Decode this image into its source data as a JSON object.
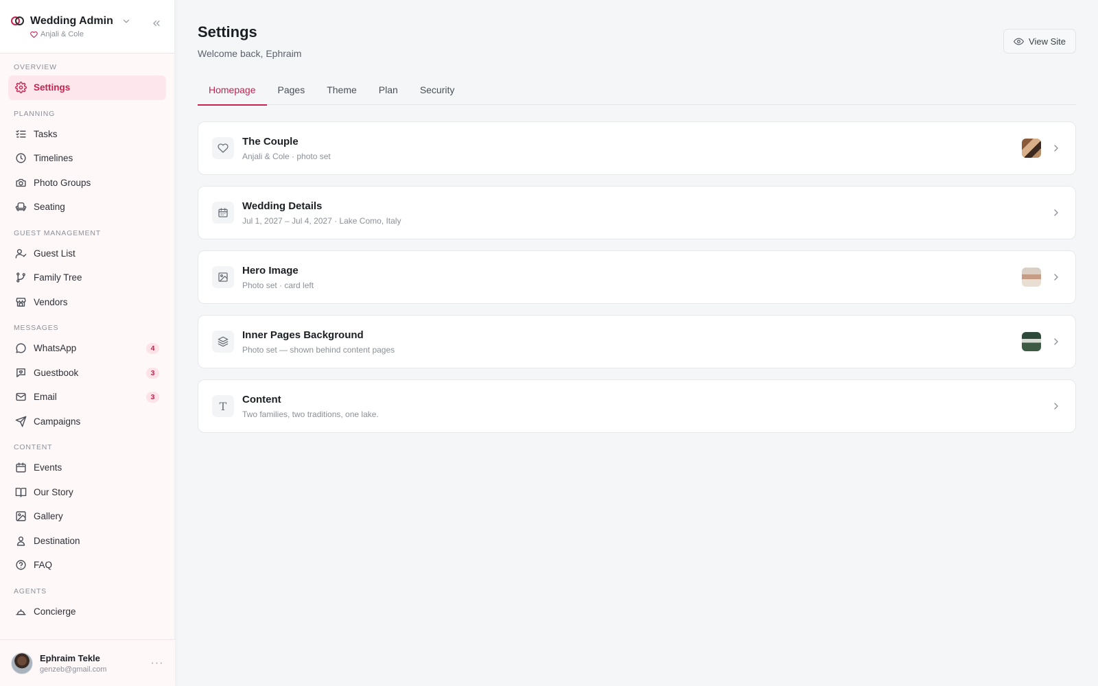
{
  "brand": {
    "title": "Wedding Admin",
    "subtitle": "Anjali & Cole"
  },
  "sidebar": {
    "sections": [
      {
        "label": "OVERVIEW",
        "items": [
          {
            "label": "Settings",
            "icon": "gear-icon",
            "active": true
          }
        ]
      },
      {
        "label": "PLANNING",
        "items": [
          {
            "label": "Tasks",
            "icon": "checklist-icon"
          },
          {
            "label": "Timelines",
            "icon": "clock-icon"
          },
          {
            "label": "Photo Groups",
            "icon": "camera-icon"
          },
          {
            "label": "Seating",
            "icon": "armchair-icon"
          }
        ]
      },
      {
        "label": "GUEST MANAGEMENT",
        "items": [
          {
            "label": "Guest List",
            "icon": "user-check-icon"
          },
          {
            "label": "Family Tree",
            "icon": "branch-icon"
          },
          {
            "label": "Vendors",
            "icon": "store-icon"
          }
        ]
      },
      {
        "label": "MESSAGES",
        "items": [
          {
            "label": "WhatsApp",
            "icon": "chat-bubble-icon",
            "badge": "4"
          },
          {
            "label": "Guestbook",
            "icon": "message-heart-icon",
            "badge": "3"
          },
          {
            "label": "Email",
            "icon": "mail-icon",
            "badge": "3"
          },
          {
            "label": "Campaigns",
            "icon": "send-icon"
          }
        ]
      },
      {
        "label": "CONTENT",
        "items": [
          {
            "label": "Events",
            "icon": "calendar-icon"
          },
          {
            "label": "Our Story",
            "icon": "book-icon"
          },
          {
            "label": "Gallery",
            "icon": "image-icon"
          },
          {
            "label": "Destination",
            "icon": "map-pin-icon"
          },
          {
            "label": "FAQ",
            "icon": "help-circle-icon"
          }
        ]
      },
      {
        "label": "AGENTS",
        "items": [
          {
            "label": "Concierge",
            "icon": "concierge-icon"
          }
        ]
      }
    ]
  },
  "user": {
    "name": "Ephraim Tekle",
    "email": "genzeb@gmail.com"
  },
  "header": {
    "title": "Settings",
    "subtitle": "Welcome back, Ephraim",
    "view_site_label": "View Site"
  },
  "tabs": [
    {
      "label": "Homepage",
      "active": true
    },
    {
      "label": "Pages"
    },
    {
      "label": "Theme"
    },
    {
      "label": "Plan"
    },
    {
      "label": "Security"
    }
  ],
  "cards": [
    {
      "title": "The Couple",
      "subtitle": "Anjali & Cole · photo set",
      "icon": "heart-icon",
      "thumb": "couple"
    },
    {
      "title": "Wedding Details",
      "subtitle": "Jul 1, 2027 – Jul 4, 2027 · Lake Como, Italy",
      "icon": "calendar-icon",
      "thumb": ""
    },
    {
      "title": "Hero Image",
      "subtitle": "Photo set · card left",
      "icon": "image-icon",
      "thumb": "hero"
    },
    {
      "title": "Inner Pages Background",
      "subtitle": "Photo set — shown behind content pages",
      "icon": "layers-icon",
      "thumb": "inner"
    },
    {
      "title": "Content",
      "subtitle": "Two families, two traditions, one lake.",
      "icon": "text-icon",
      "thumb": ""
    }
  ],
  "colors": {
    "accent": "#c8214f",
    "background": "#f5f6f8",
    "sidebar": "#fff8f9"
  }
}
